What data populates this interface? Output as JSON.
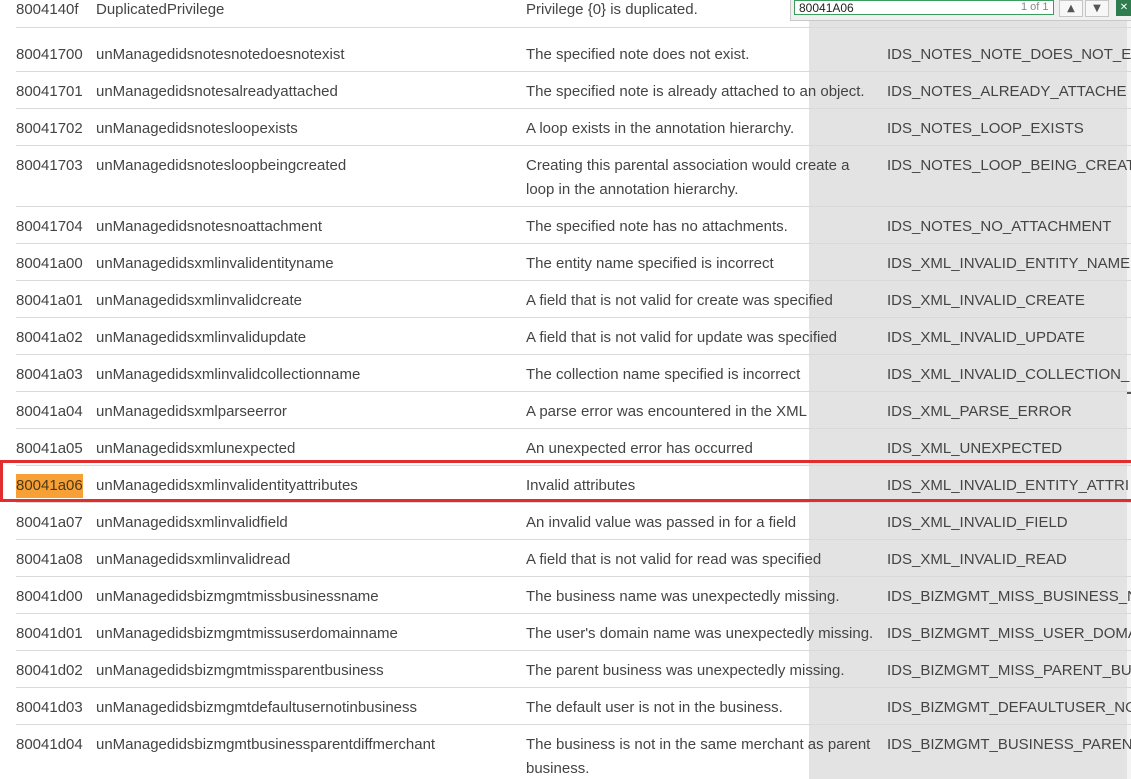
{
  "find": {
    "query": "80041A06",
    "count": "1 of 1",
    "prev_icon": "chevron-up-icon",
    "next_icon": "chevron-down-icon",
    "close_icon": "close-icon"
  },
  "colors": {
    "highlight": "#f7a035",
    "annotation_box": "#e32c2c",
    "findbar_border": "#3a9d5d"
  },
  "rows": [
    {
      "code": "8004140f",
      "name": "DuplicatedPrivilege",
      "desc": "Privilege {0} is duplicated.",
      "id": ""
    },
    {
      "code": "80041700",
      "name": "unManagedidsnotesnotedoesnotexist",
      "desc": "The specified note does not exist.",
      "id": "IDS_NOTES_NOTE_DOES_NOT_E"
    },
    {
      "code": "80041701",
      "name": "unManagedidsnotesalreadyattached",
      "desc": "The specified note is already attached to an object.",
      "id": "IDS_NOTES_ALREADY_ATTACHE"
    },
    {
      "code": "80041702",
      "name": "unManagedidsnotesloopexists",
      "desc": "A loop exists in the annotation hierarchy.",
      "id": "IDS_NOTES_LOOP_EXISTS"
    },
    {
      "code": "80041703",
      "name": "unManagedidsnotesloopbeingcreated",
      "desc": "Creating this parental association would create a loop in the annotation hierarchy.",
      "id": "IDS_NOTES_LOOP_BEING_CREAT"
    },
    {
      "code": "80041704",
      "name": "unManagedidsnotesnoattachment",
      "desc": "The specified note has no attachments.",
      "id": "IDS_NOTES_NO_ATTACHMENT"
    },
    {
      "code": "80041a00",
      "name": "unManagedidsxmlinvalidentityname",
      "desc": "The entity name specified is incorrect",
      "id": "IDS_XML_INVALID_ENTITY_NAME"
    },
    {
      "code": "80041a01",
      "name": "unManagedidsxmlinvalidcreate",
      "desc": "A field that is not valid for create was specified",
      "id": "IDS_XML_INVALID_CREATE"
    },
    {
      "code": "80041a02",
      "name": "unManagedidsxmlinvalidupdate",
      "desc": "A field that is not valid for update was specified",
      "id": "IDS_XML_INVALID_UPDATE"
    },
    {
      "code": "80041a03",
      "name": "unManagedidsxmlinvalidcollectionname",
      "desc": "The collection name specified is incorrect",
      "id": "IDS_XML_INVALID_COLLECTION_"
    },
    {
      "code": "80041a04",
      "name": "unManagedidsxmlparseerror",
      "desc": "A parse error was encountered in the XML",
      "id": "IDS_XML_PARSE_ERROR"
    },
    {
      "code": "80041a05",
      "name": "unManagedidsxmlunexpected",
      "desc": "An unexpected error has occurred",
      "id": "IDS_XML_UNEXPECTED"
    },
    {
      "code": "80041a06",
      "name": "unManagedidsxmlinvalidentityattributes",
      "desc": "Invalid attributes",
      "id": "IDS_XML_INVALID_ENTITY_ATTRI",
      "highlighted": true
    },
    {
      "code": "80041a07",
      "name": "unManagedidsxmlinvalidfield",
      "desc": "An invalid value was passed in for a field",
      "id": "IDS_XML_INVALID_FIELD"
    },
    {
      "code": "80041a08",
      "name": "unManagedidsxmlinvalidread",
      "desc": "A field that is not valid for read was specified",
      "id": "IDS_XML_INVALID_READ"
    },
    {
      "code": "80041d00",
      "name": "unManagedidsbizmgmtmissbusinessname",
      "desc": "The business name was unexpectedly missing.",
      "id": "IDS_BIZMGMT_MISS_BUSINESS_N"
    },
    {
      "code": "80041d01",
      "name": "unManagedidsbizmgmtmissuserdomainname",
      "desc": "The user's domain name was unexpectedly missing.",
      "id": "IDS_BIZMGMT_MISS_USER_DOMA"
    },
    {
      "code": "80041d02",
      "name": "unManagedidsbizmgmtmissparentbusiness",
      "desc": "The parent business was unexpectedly missing.",
      "id": "IDS_BIZMGMT_MISS_PARENT_BU"
    },
    {
      "code": "80041d03",
      "name": "unManagedidsbizmgmtdefaultusernotinbusiness",
      "desc": "The default user is not in the business.",
      "id": "IDS_BIZMGMT_DEFAULTUSER_NO"
    },
    {
      "code": "80041d04",
      "name": "unManagedidsbizmgmtbusinessparentdiffmerchant",
      "desc": "The business is not in the same merchant as parent business.",
      "id": "IDS_BIZMGMT_BUSINESS_PAREN"
    }
  ]
}
